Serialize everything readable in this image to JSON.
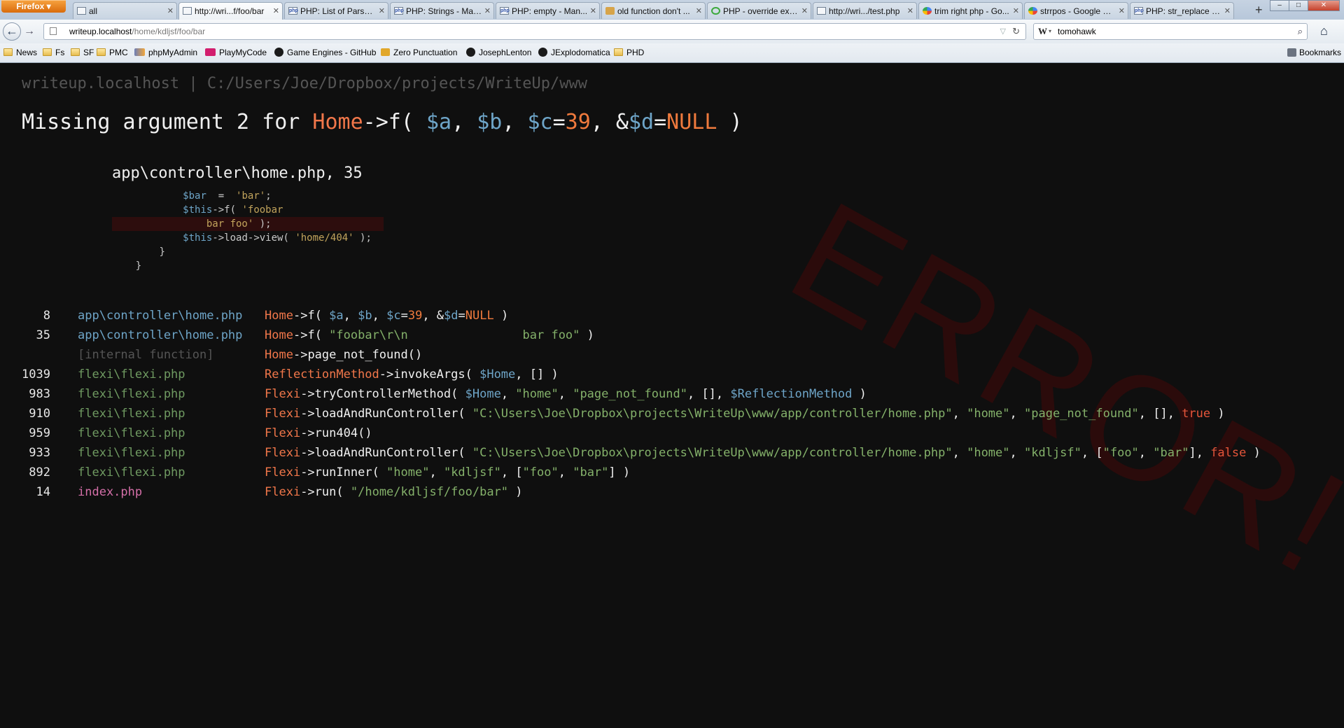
{
  "browser": {
    "app_button": "Firefox ▾",
    "tabs": [
      {
        "label": "all",
        "icon": "page-icon"
      },
      {
        "label": "http://wri...f/foo/bar",
        "icon": "page-icon"
      },
      {
        "label": "PHP: List of Parser ...",
        "icon": "php-icon"
      },
      {
        "label": "PHP: Strings - Man...",
        "icon": "php-icon"
      },
      {
        "label": "PHP: empty - Man...",
        "icon": "php-icon"
      },
      {
        "label": "old function don't ...",
        "icon": "jar-icon"
      },
      {
        "label": "PHP - override exis...",
        "icon": "loading-icon"
      },
      {
        "label": "http://wri.../test.php",
        "icon": "page-icon"
      },
      {
        "label": "trim right php - Go...",
        "icon": "google-icon"
      },
      {
        "label": "strrpos - Google Se...",
        "icon": "google-icon"
      },
      {
        "label": "PHP: str_replace - ...",
        "icon": "php-icon"
      }
    ],
    "new_tab": "+",
    "url_host": "writeup.localhost",
    "url_path": "/home/kdljsf/foo/bar",
    "search_engine_letter": "W",
    "search_text": "tomohawk",
    "bookmarks": [
      {
        "label": "News",
        "icon": "folder-icon"
      },
      {
        "label": "Fs",
        "icon": "folder-icon"
      },
      {
        "label": "SF",
        "icon": "folder-icon"
      },
      {
        "label": "PMC",
        "icon": "folder-icon"
      },
      {
        "label": "phpMyAdmin",
        "icon": "phpmyadmin-icon"
      },
      {
        "label": "PlayMyCode",
        "icon": "playmycode-icon"
      },
      {
        "label": "Game Engines - GitHub",
        "icon": "github-icon"
      },
      {
        "label": "Zero Punctuation",
        "icon": "zp-icon"
      },
      {
        "label": "JosephLenton",
        "icon": "github-icon"
      },
      {
        "label": "JExplodomatica",
        "icon": "github-icon"
      },
      {
        "label": "PHD",
        "icon": "folder-icon"
      }
    ],
    "bookmarks_menu": "Bookmarks"
  },
  "page": {
    "header": "writeup.localhost | C:/Users/Joe/Dropbox/projects/WriteUp/www",
    "watermark": "ERROR!",
    "error": {
      "prefix": "Missing argument 2 for ",
      "class": "Home",
      "arrow": "->",
      "method": "f",
      "open": "( ",
      "a": "$a",
      "sep1": ", ",
      "b": "$b",
      "sep2": ", ",
      "c": "$c",
      "eq1": "=",
      "c_default": "39",
      "sep3": ", ",
      "amp": "&",
      "d": "$d",
      "eq2": "=",
      "d_default": "NULL",
      "close": " )"
    },
    "snippet_file": "app\\controller\\home.php, 35",
    "snippet_lines": [
      {
        "indent": "            ",
        "parts": [
          {
            "t": "var",
            "v": "$bar"
          },
          {
            "t": "plain",
            "v": "  =  "
          },
          {
            "t": "str",
            "v": "'bar'"
          },
          {
            "t": "plain",
            "v": ";"
          }
        ]
      },
      {
        "indent": "            ",
        "parts": [
          {
            "t": "var",
            "v": "$this"
          },
          {
            "t": "plain",
            "v": "->f( "
          },
          {
            "t": "str",
            "v": "'foobar"
          }
        ]
      },
      {
        "indent": "                ",
        "parts": [
          {
            "t": "str",
            "v": "bar foo'"
          },
          {
            "t": "plain",
            "v": " );"
          }
        ],
        "highlight": true
      },
      {
        "indent": "            ",
        "parts": [
          {
            "t": "var",
            "v": "$this"
          },
          {
            "t": "plain",
            "v": "->load->view( "
          },
          {
            "t": "str",
            "v": "'home/404'"
          },
          {
            "t": "plain",
            "v": " );"
          }
        ]
      },
      {
        "indent": "        ",
        "parts": [
          {
            "t": "plain",
            "v": "}"
          }
        ]
      },
      {
        "indent": "    ",
        "parts": [
          {
            "t": "plain",
            "v": "}"
          }
        ]
      }
    ],
    "trace": [
      {
        "line": "8",
        "file": "app\\controller\\home.php",
        "kind": "app",
        "call": [
          {
            "t": "cls",
            "v": "Home"
          },
          {
            "t": "arrow",
            "v": "->"
          },
          {
            "t": "fn",
            "v": "f"
          },
          {
            "t": "plain",
            "v": "( "
          },
          {
            "t": "var",
            "v": "$a"
          },
          {
            "t": "plain",
            "v": ", "
          },
          {
            "t": "var",
            "v": "$b"
          },
          {
            "t": "plain",
            "v": ", "
          },
          {
            "t": "var",
            "v": "$c"
          },
          {
            "t": "plain",
            "v": "="
          },
          {
            "t": "num",
            "v": "39"
          },
          {
            "t": "plain",
            "v": ", &"
          },
          {
            "t": "var",
            "v": "$d"
          },
          {
            "t": "plain",
            "v": "="
          },
          {
            "t": "num",
            "v": "NULL"
          },
          {
            "t": "plain",
            "v": " )"
          }
        ]
      },
      {
        "line": "35",
        "file": "app\\controller\\home.php",
        "kind": "app",
        "call": [
          {
            "t": "cls",
            "v": "Home"
          },
          {
            "t": "arrow",
            "v": "->"
          },
          {
            "t": "fn",
            "v": "f"
          },
          {
            "t": "plain",
            "v": "( "
          },
          {
            "t": "str",
            "v": "\"foobar\\r\\n                bar foo\""
          },
          {
            "t": "plain",
            "v": " )"
          }
        ]
      },
      {
        "line": "",
        "file": "[internal function]",
        "kind": "internal",
        "call": [
          {
            "t": "cls",
            "v": "Home"
          },
          {
            "t": "arrow",
            "v": "->"
          },
          {
            "t": "fn",
            "v": "page_not_found"
          },
          {
            "t": "plain",
            "v": "()"
          }
        ]
      },
      {
        "line": "1039",
        "file": "flexi\\flexi.php",
        "kind": "flexi",
        "call": [
          {
            "t": "cls",
            "v": "ReflectionMethod"
          },
          {
            "t": "arrow",
            "v": "->"
          },
          {
            "t": "fn",
            "v": "invokeArgs"
          },
          {
            "t": "plain",
            "v": "( "
          },
          {
            "t": "var",
            "v": "$Home"
          },
          {
            "t": "plain",
            "v": ", [] )"
          }
        ]
      },
      {
        "line": "983",
        "file": "flexi\\flexi.php",
        "kind": "flexi",
        "call": [
          {
            "t": "cls",
            "v": "Flexi"
          },
          {
            "t": "arrow",
            "v": "->"
          },
          {
            "t": "fn",
            "v": "tryControllerMethod"
          },
          {
            "t": "plain",
            "v": "( "
          },
          {
            "t": "var",
            "v": "$Home"
          },
          {
            "t": "plain",
            "v": ", "
          },
          {
            "t": "str",
            "v": "\"home\""
          },
          {
            "t": "plain",
            "v": ", "
          },
          {
            "t": "str",
            "v": "\"page_not_found\""
          },
          {
            "t": "plain",
            "v": ", [], "
          },
          {
            "t": "var",
            "v": "$ReflectionMethod"
          },
          {
            "t": "plain",
            "v": " )"
          }
        ]
      },
      {
        "line": "910",
        "file": "flexi\\flexi.php",
        "kind": "flexi",
        "call": [
          {
            "t": "cls",
            "v": "Flexi"
          },
          {
            "t": "arrow",
            "v": "->"
          },
          {
            "t": "fn",
            "v": "loadAndRunController"
          },
          {
            "t": "plain",
            "v": "( "
          },
          {
            "t": "str",
            "v": "\"C:\\Users\\Joe\\Dropbox\\projects\\WriteUp\\www/app/controller/home.php\""
          },
          {
            "t": "plain",
            "v": ", "
          },
          {
            "t": "str",
            "v": "\"home\""
          },
          {
            "t": "plain",
            "v": ", "
          },
          {
            "t": "str",
            "v": "\"page_not_found\""
          },
          {
            "t": "plain",
            "v": ", [], "
          },
          {
            "t": "bool",
            "v": "true"
          },
          {
            "t": "plain",
            "v": " )"
          }
        ]
      },
      {
        "line": "959",
        "file": "flexi\\flexi.php",
        "kind": "flexi",
        "call": [
          {
            "t": "cls",
            "v": "Flexi"
          },
          {
            "t": "arrow",
            "v": "->"
          },
          {
            "t": "fn",
            "v": "run404"
          },
          {
            "t": "plain",
            "v": "()"
          }
        ]
      },
      {
        "line": "933",
        "file": "flexi\\flexi.php",
        "kind": "flexi",
        "call": [
          {
            "t": "cls",
            "v": "Flexi"
          },
          {
            "t": "arrow",
            "v": "->"
          },
          {
            "t": "fn",
            "v": "loadAndRunController"
          },
          {
            "t": "plain",
            "v": "( "
          },
          {
            "t": "str",
            "v": "\"C:\\Users\\Joe\\Dropbox\\projects\\WriteUp\\www/app/controller/home.php\""
          },
          {
            "t": "plain",
            "v": ", "
          },
          {
            "t": "str",
            "v": "\"home\""
          },
          {
            "t": "plain",
            "v": ", "
          },
          {
            "t": "str",
            "v": "\"kdljsf\""
          },
          {
            "t": "plain",
            "v": ", ["
          },
          {
            "t": "str",
            "v": "\"foo\""
          },
          {
            "t": "plain",
            "v": ", "
          },
          {
            "t": "str",
            "v": "\"bar\""
          },
          {
            "t": "plain",
            "v": "], "
          },
          {
            "t": "bool",
            "v": "false"
          },
          {
            "t": "plain",
            "v": " )"
          }
        ]
      },
      {
        "line": "892",
        "file": "flexi\\flexi.php",
        "kind": "flexi",
        "call": [
          {
            "t": "cls",
            "v": "Flexi"
          },
          {
            "t": "arrow",
            "v": "->"
          },
          {
            "t": "fn",
            "v": "runInner"
          },
          {
            "t": "plain",
            "v": "( "
          },
          {
            "t": "str",
            "v": "\"home\""
          },
          {
            "t": "plain",
            "v": ", "
          },
          {
            "t": "str",
            "v": "\"kdljsf\""
          },
          {
            "t": "plain",
            "v": ", ["
          },
          {
            "t": "str",
            "v": "\"foo\""
          },
          {
            "t": "plain",
            "v": ", "
          },
          {
            "t": "str",
            "v": "\"bar\""
          },
          {
            "t": "plain",
            "v": "] )"
          }
        ]
      },
      {
        "line": "14",
        "file": "index.php",
        "kind": "index",
        "call": [
          {
            "t": "cls",
            "v": "Flexi"
          },
          {
            "t": "arrow",
            "v": "->"
          },
          {
            "t": "fn",
            "v": "run"
          },
          {
            "t": "plain",
            "v": "( "
          },
          {
            "t": "str",
            "v": "\"/home/kdljsf/foo/bar\""
          },
          {
            "t": "plain",
            "v": " )"
          }
        ]
      }
    ]
  },
  "colors": {
    "background": "#0f0f0f",
    "class": "#f1774a",
    "variable": "#6ea5c8",
    "string": "#84b16a",
    "number": "#ef7a3d",
    "boolean": "#e5553a",
    "watermark": "#2b0b0b"
  }
}
